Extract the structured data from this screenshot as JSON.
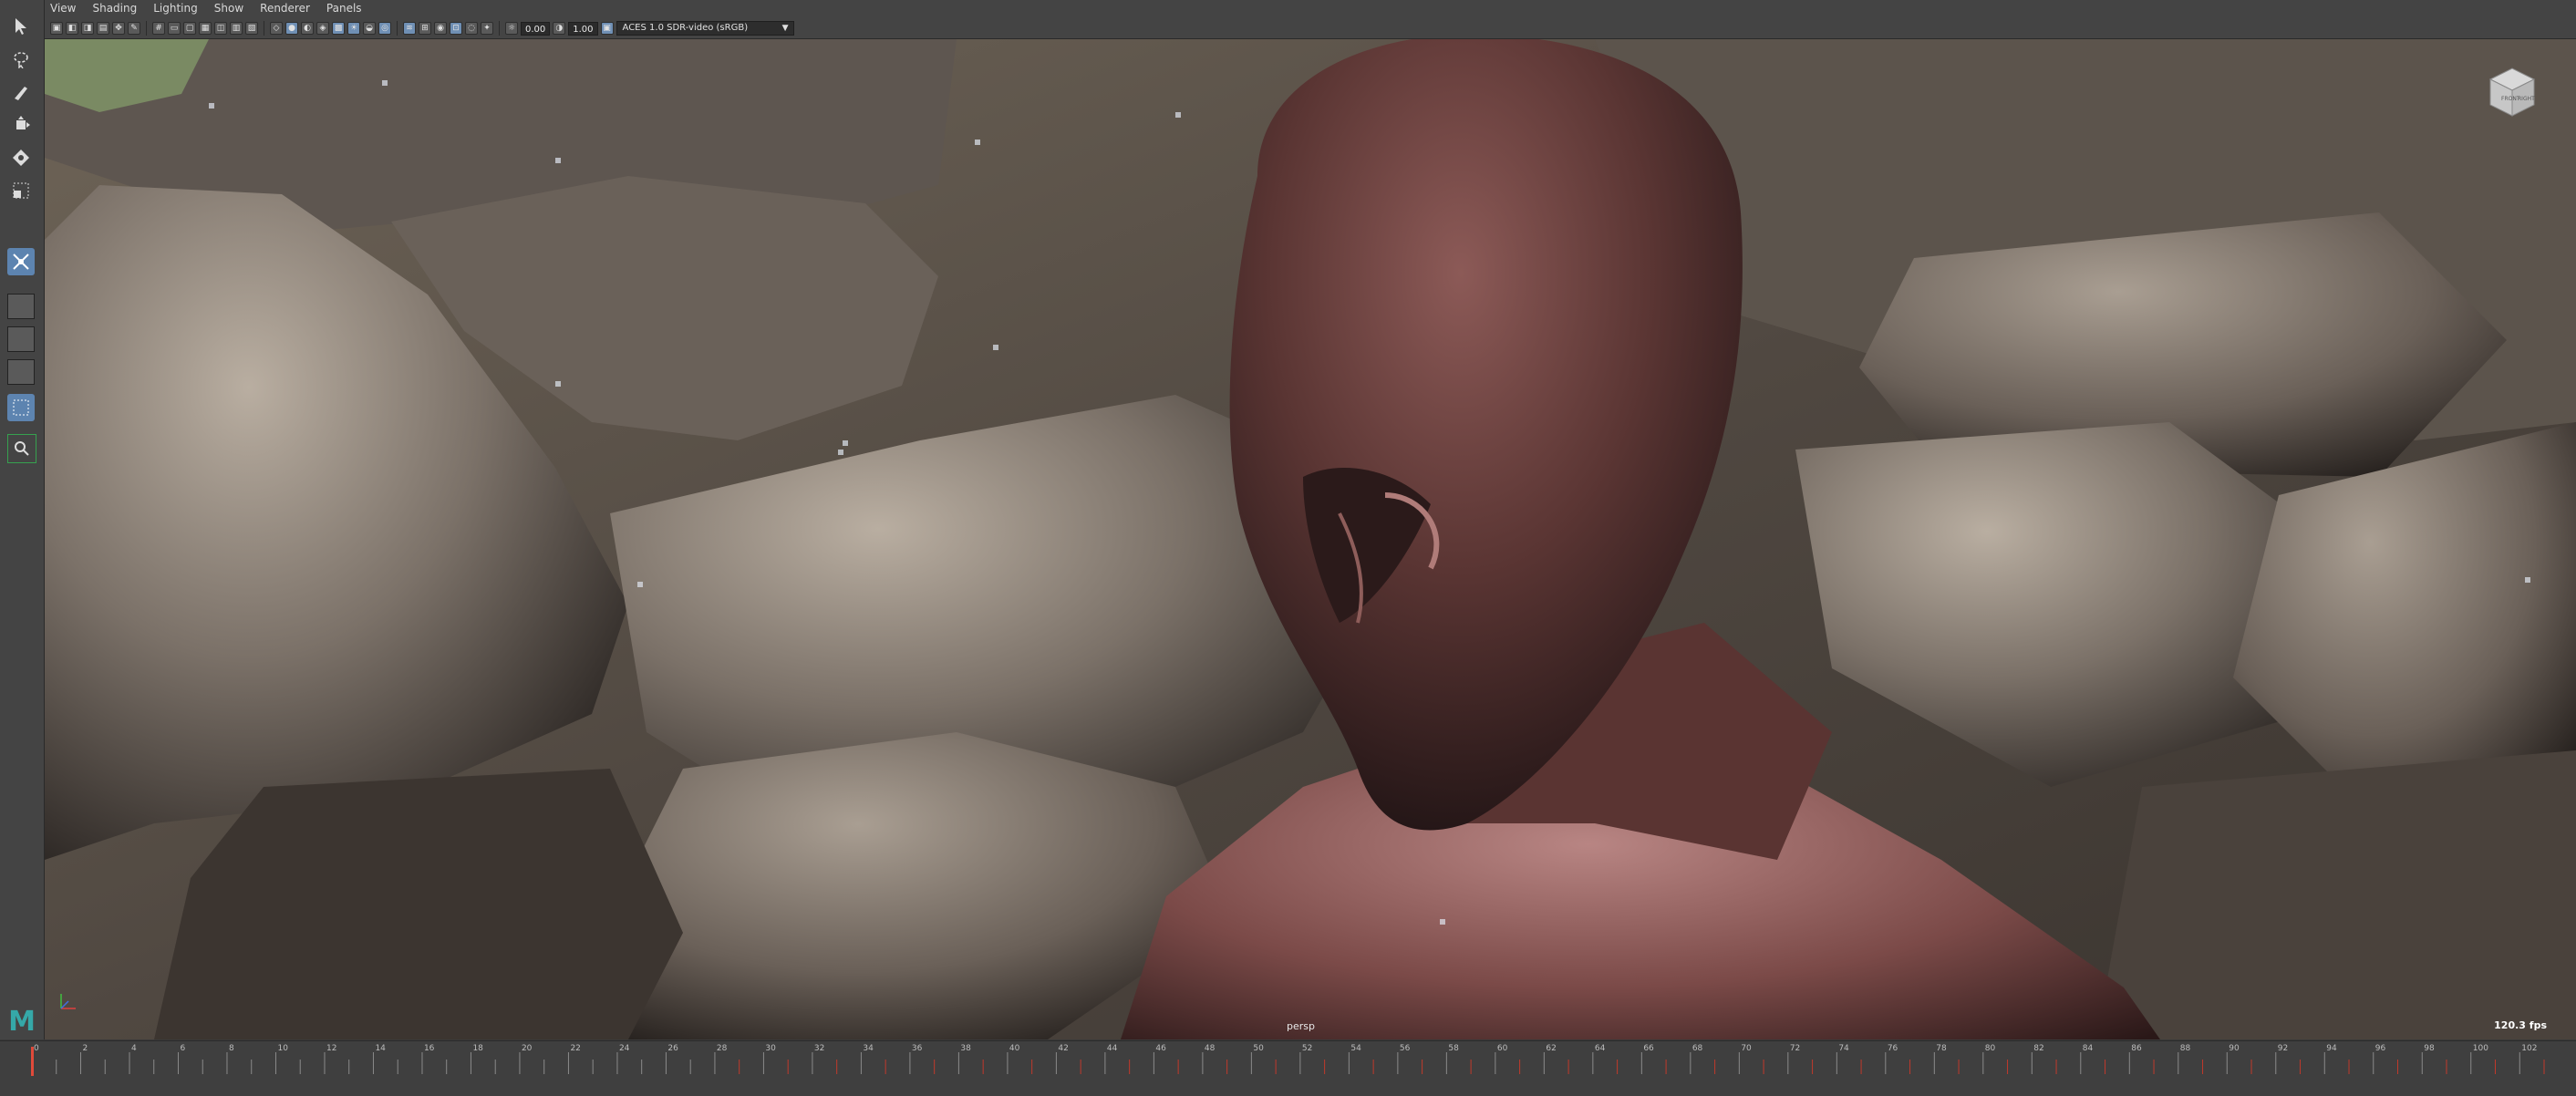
{
  "menu": {
    "items": [
      "View",
      "Shading",
      "Lighting",
      "Show",
      "Renderer",
      "Panels"
    ]
  },
  "toolbar": {
    "exposure_value": "0.00",
    "gamma_value": "1.00",
    "colorspace": "ACES 1.0 SDR-video (sRGB)"
  },
  "viewport": {
    "camera_label": "persp",
    "fps_label": "120.3 fps",
    "viewcube_front": "FRONT",
    "viewcube_right": "RIGHT"
  },
  "logo": "M",
  "timeslider": {
    "ticks": [
      "0",
      "2",
      "4",
      "6",
      "8",
      "10",
      "12",
      "14",
      "16",
      "18",
      "20",
      "22",
      "24",
      "26",
      "28",
      "30",
      "32",
      "34",
      "36",
      "38",
      "40",
      "42",
      "44",
      "46",
      "48",
      "50",
      "52",
      "54",
      "56",
      "58",
      "60",
      "62",
      "64",
      "66",
      "68",
      "70",
      "72",
      "74",
      "76",
      "78",
      "80",
      "82",
      "84",
      "86",
      "88",
      "90",
      "92",
      "94",
      "96",
      "98",
      "100",
      "102"
    ],
    "current_frame": 0
  },
  "colors": {
    "accent": "#5d84b0",
    "keyframe_red": "#c0392b",
    "maya_logo": "#35a8a8"
  }
}
